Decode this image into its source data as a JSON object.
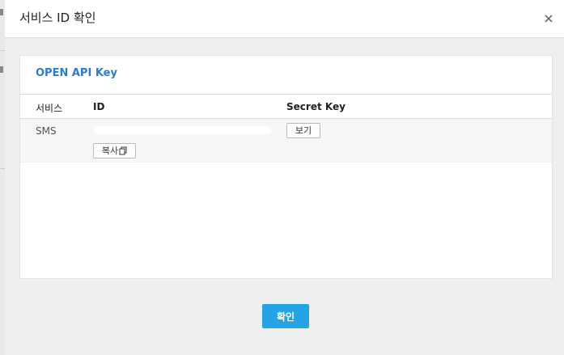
{
  "dialog": {
    "title": "서비스 ID 확인"
  },
  "panel": {
    "title": "OPEN API Key",
    "columns": {
      "service": "서비스",
      "id": "ID",
      "secret_key": "Secret Key"
    },
    "rows": [
      {
        "service": "SMS",
        "id": "",
        "copy_label": "복사",
        "view_label": "보기"
      }
    ]
  },
  "footer": {
    "confirm_label": "확인"
  },
  "colors": {
    "accent": "#2a7ad1",
    "primary_button": "#22a4e6"
  },
  "icons": {
    "close": "close-icon",
    "copy": "copy-icon"
  }
}
